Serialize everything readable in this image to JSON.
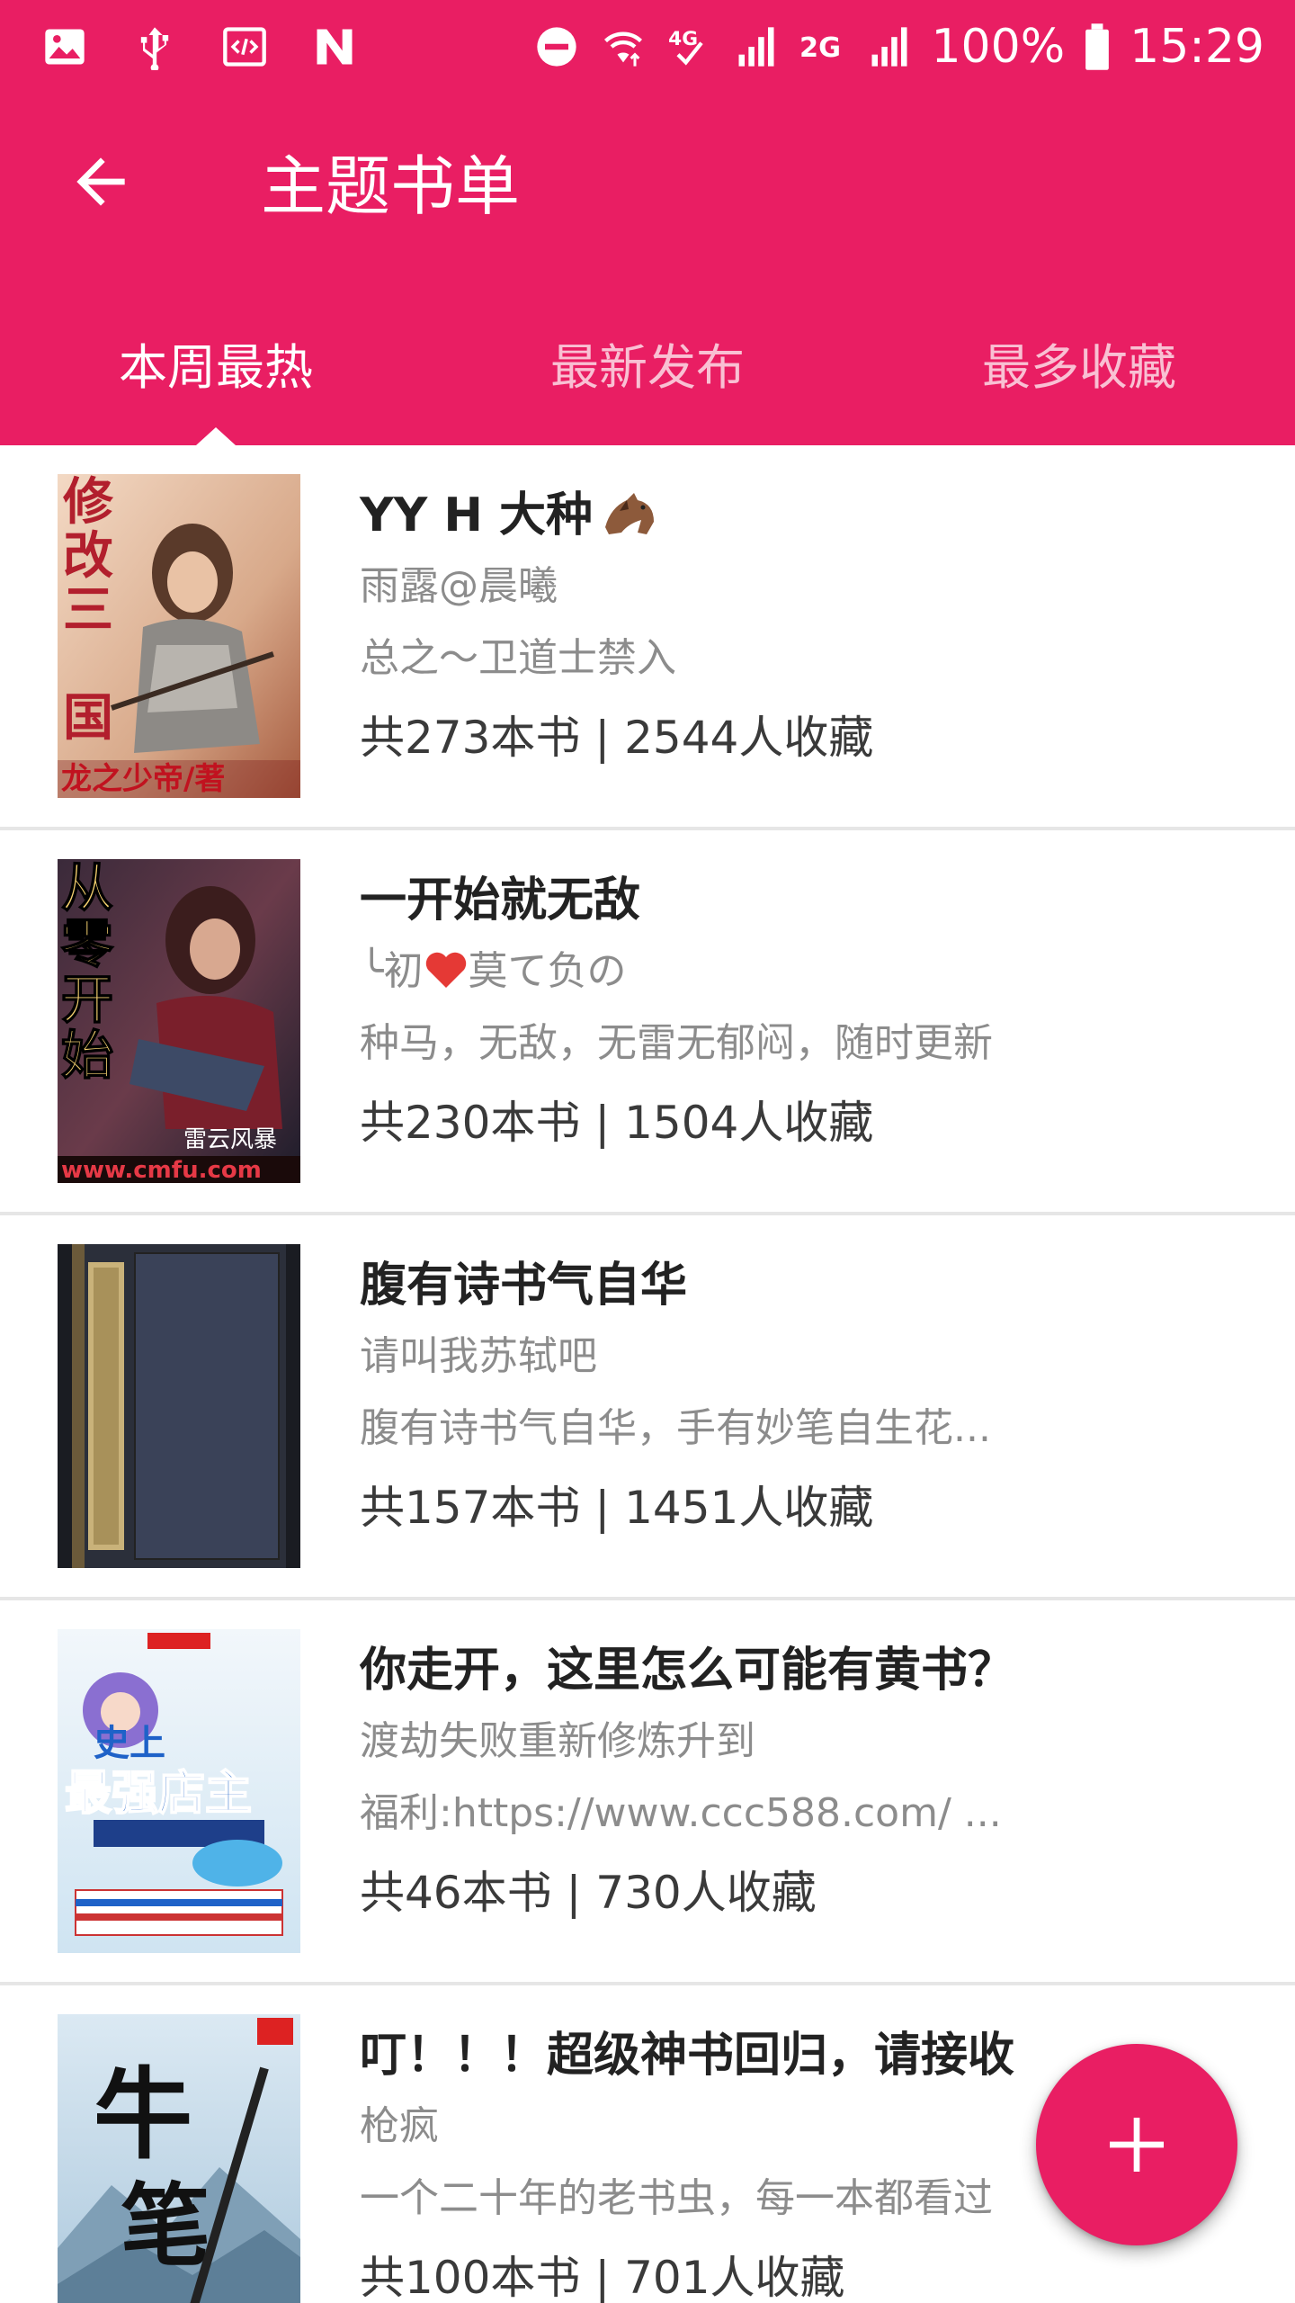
{
  "status_bar": {
    "left_icons": [
      "image-icon",
      "usb-icon",
      "code-icon",
      "n-app-icon"
    ],
    "right_icons": [
      "do-not-disturb-icon",
      "wifi-icon",
      "4g-icon",
      "signal-icon",
      "2g-icon",
      "signal-icon",
      "battery-icon"
    ],
    "battery": "100%",
    "time": "15:29"
  },
  "toolbar": {
    "back_icon": "arrow-back-icon",
    "title": "主题书单"
  },
  "tabs": [
    {
      "label": "本周最热",
      "active": true
    },
    {
      "label": "最新发布",
      "active": false
    },
    {
      "label": "最多收藏",
      "active": false
    }
  ],
  "booklists": [
    {
      "title": "YY H 大种",
      "title_emoji": "horse-emoji",
      "author": "雨露@晨曦",
      "description": "总之～卫道士禁入",
      "stats": "共273本书 | 2544人收藏",
      "cover_text": [
        "修",
        "改",
        "三",
        "国",
        "龙之少帝/著"
      ]
    },
    {
      "title": "一开始就无敌",
      "author_prefix": "╰初",
      "author_emoji": "heart-emoji",
      "author_suffix": "莫て负の",
      "description": "种马，无敌，无雷无郁闷，随时更新",
      "stats": "共230本书 | 1504人收藏",
      "cover_text": [
        "从",
        "零",
        "开",
        "始",
        "雷云风暴",
        "www.cmfu.com"
      ]
    },
    {
      "title": "腹有诗书气自华",
      "author": "请叫我苏轼吧",
      "description": "腹有诗书气自华，手有妙笔自生花...",
      "stats": "共157本书 | 1451人收藏",
      "cover_text": []
    },
    {
      "title": "你走开，这里怎么可能有黄书？",
      "author": "渡劫失败重新修炼升到",
      "description": "福利:https://www.ccc588.com/ ...",
      "stats": "共46本书 | 730人收藏",
      "cover_text": [
        "史上",
        "最强店主"
      ]
    },
    {
      "title": "叮！！！超级神书回归，请接收",
      "author": "枪疯",
      "description": "一个二十年的老书虫，每一本都看过",
      "stats": "共100本书 | 701人收藏",
      "cover_text": [
        "牛",
        "笔"
      ]
    }
  ],
  "fab": {
    "icon": "plus-icon"
  },
  "colors": {
    "primary": "#e91e63",
    "title_text": "#222222",
    "secondary_text": "#8c8c8c",
    "stats_text": "#3a3a3a",
    "divider": "#e6e6e6"
  }
}
